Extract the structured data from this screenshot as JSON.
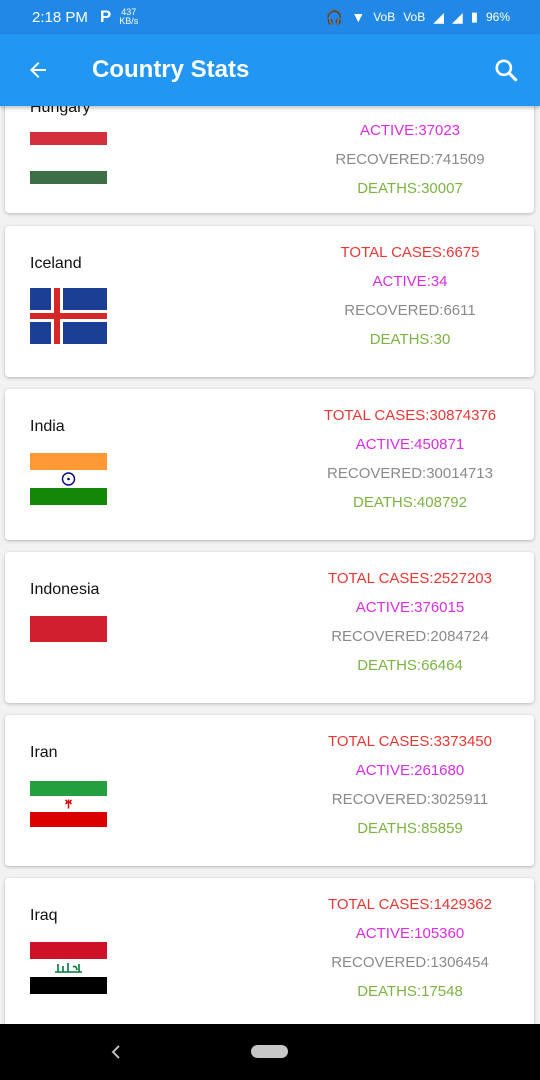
{
  "status_bar": {
    "time": "2:18 PM",
    "app_icon": "P",
    "speed_value": "437",
    "speed_unit": "KB/s",
    "vo1": "VoB",
    "vo2": "VoB",
    "battery": "96%"
  },
  "app_bar": {
    "title": "Country Stats",
    "back_icon": "arrow-left-icon",
    "search_icon": "search-icon"
  },
  "countries": [
    {
      "name": "Hungary",
      "total": "",
      "active": "ACTIVE:37023",
      "recovered": "RECOVERED:741509",
      "deaths": "DEATHS:30007"
    },
    {
      "name": "Iceland",
      "total": "TOTAL CASES:6675",
      "active": "ACTIVE:34",
      "recovered": "RECOVERED:6611",
      "deaths": "DEATHS:30"
    },
    {
      "name": "India",
      "total": "TOTAL CASES:30874376",
      "active": "ACTIVE:450871",
      "recovered": "RECOVERED:30014713",
      "deaths": "DEATHS:408792"
    },
    {
      "name": "Indonesia",
      "total": "TOTAL CASES:2527203",
      "active": "ACTIVE:376015",
      "recovered": "RECOVERED:2084724",
      "deaths": "DEATHS:66464"
    },
    {
      "name": "Iran",
      "total": "TOTAL CASES:3373450",
      "active": "ACTIVE:261680",
      "recovered": "RECOVERED:3025911",
      "deaths": "DEATHS:85859"
    },
    {
      "name": "Iraq",
      "total": "TOTAL CASES:1429362",
      "active": "ACTIVE:105360",
      "recovered": "RECOVERED:1306454",
      "deaths": "DEATHS:17548"
    }
  ],
  "colors": {
    "primary": "#2196f3",
    "total": "#e53935",
    "active": "#d62ee0",
    "recovered": "#8a8a8a",
    "deaths": "#7cb342"
  }
}
